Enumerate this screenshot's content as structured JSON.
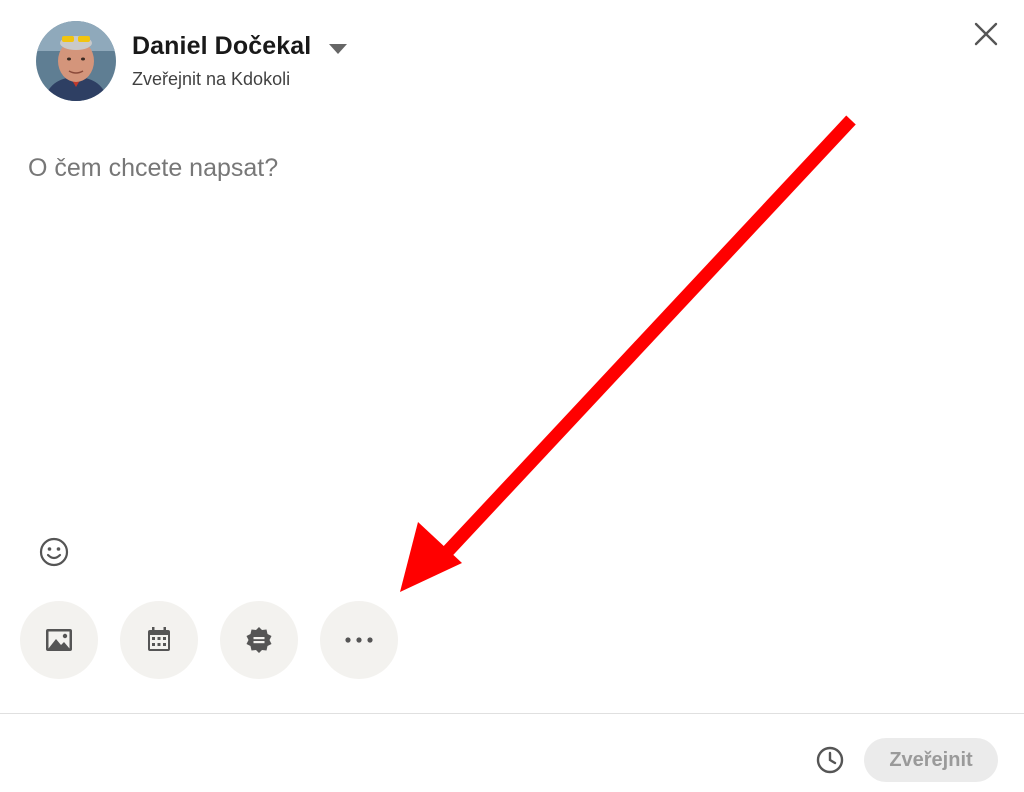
{
  "author": {
    "name": "Daniel Dočekal",
    "visibility": "Zveřejnit na Kdokoli"
  },
  "editor": {
    "placeholder": "O čem chcete napsat?"
  },
  "toolbar": {
    "emoji_icon": "smiley-icon",
    "tools": [
      {
        "icon": "image-icon"
      },
      {
        "icon": "calendar-icon"
      },
      {
        "icon": "badge-icon"
      },
      {
        "icon": "more-icon"
      }
    ]
  },
  "footer": {
    "schedule_icon": "clock-icon",
    "post_label": "Zveřejnit"
  },
  "annotation": {
    "arrow_color": "#ff0000"
  },
  "colors": {
    "tool_bg": "#f3f2ef",
    "post_disabled_bg": "#ebebeb",
    "post_disabled_text": "#9a9a9a"
  }
}
